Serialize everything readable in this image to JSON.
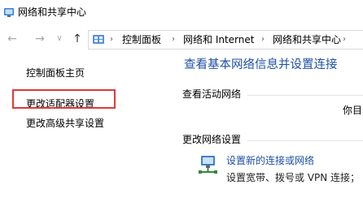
{
  "window": {
    "title": "网络和共享中心",
    "icon": "network-sharing-center-icon"
  },
  "nav": {
    "back": "←",
    "forward": "→",
    "recent": "∨",
    "up": "↑",
    "address_icon": "control-panel-icon",
    "separator": "›",
    "breadcrumb": [
      "控制面板",
      "网络和 Internet",
      "网络和共享中心"
    ]
  },
  "sidebar": {
    "home": "控制面板主页",
    "change_adapter": "更改适配器设置",
    "advanced_sharing": "更改高级共享设置"
  },
  "main": {
    "heading": "查看基本网络信息并设置连接",
    "active_networks_label": "查看活动网络",
    "active_network_partial": "你目",
    "change_settings_label": "更改网络设置",
    "setup_connection_link": "设置新的连接或网络",
    "setup_connection_desc": "设置宽带、拨号或 VPN 连接；"
  },
  "colors": {
    "link": "#1e4fa3",
    "highlight_box": "#e03a36"
  }
}
